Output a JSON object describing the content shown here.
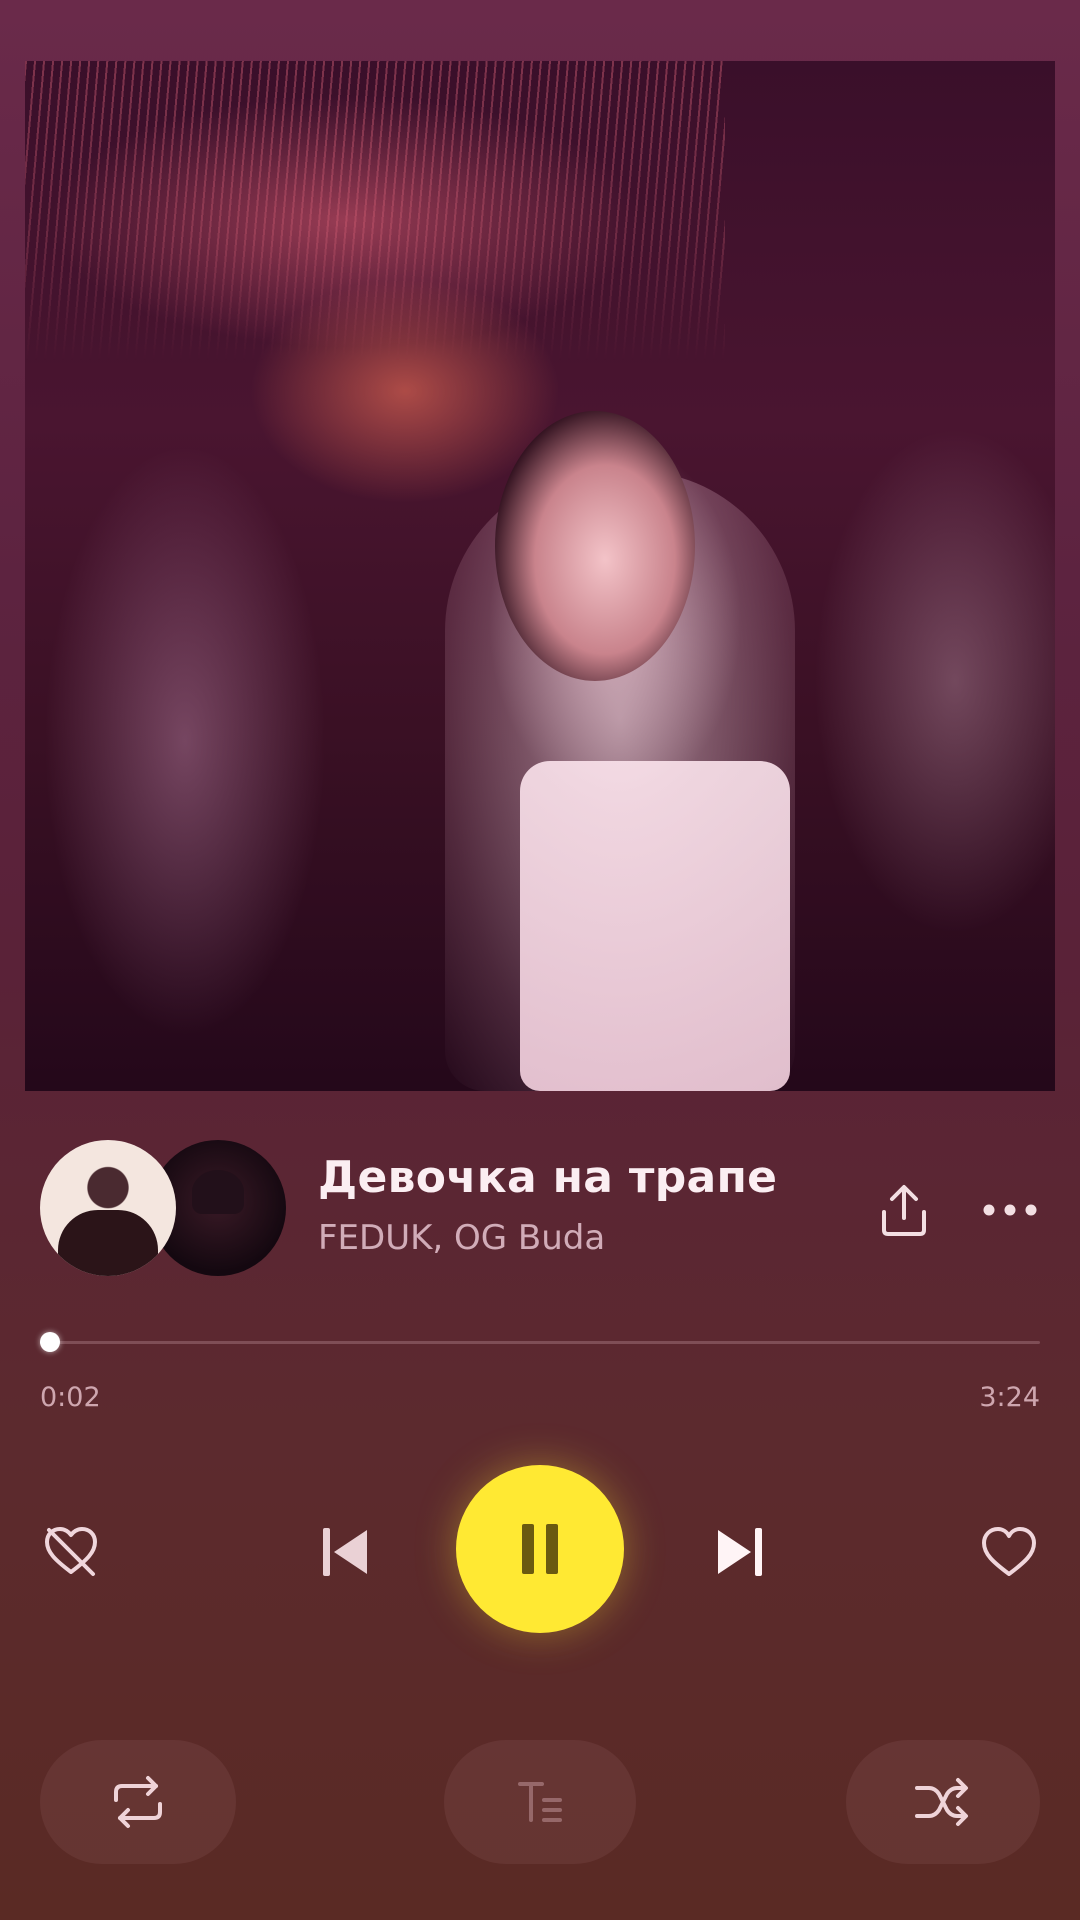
{
  "track": {
    "title": "Девочка на трапе",
    "artists": "FEDUK, OG Buda"
  },
  "progress": {
    "current": "0:02",
    "total": "3:24",
    "fraction": 0.01
  },
  "icons": {
    "share": "share-icon",
    "more": "more-icon",
    "dislike": "dislike-icon",
    "previous": "skip-previous-icon",
    "play_pause": "pause-icon",
    "next": "skip-next-icon",
    "like": "heart-icon",
    "repeat": "repeat-icon",
    "lyrics": "lyrics-icon",
    "shuffle": "shuffle-icon"
  },
  "colors": {
    "accent": "#ffe933",
    "background_top": "#6a2a4a",
    "background_bottom": "#5a2a24"
  }
}
